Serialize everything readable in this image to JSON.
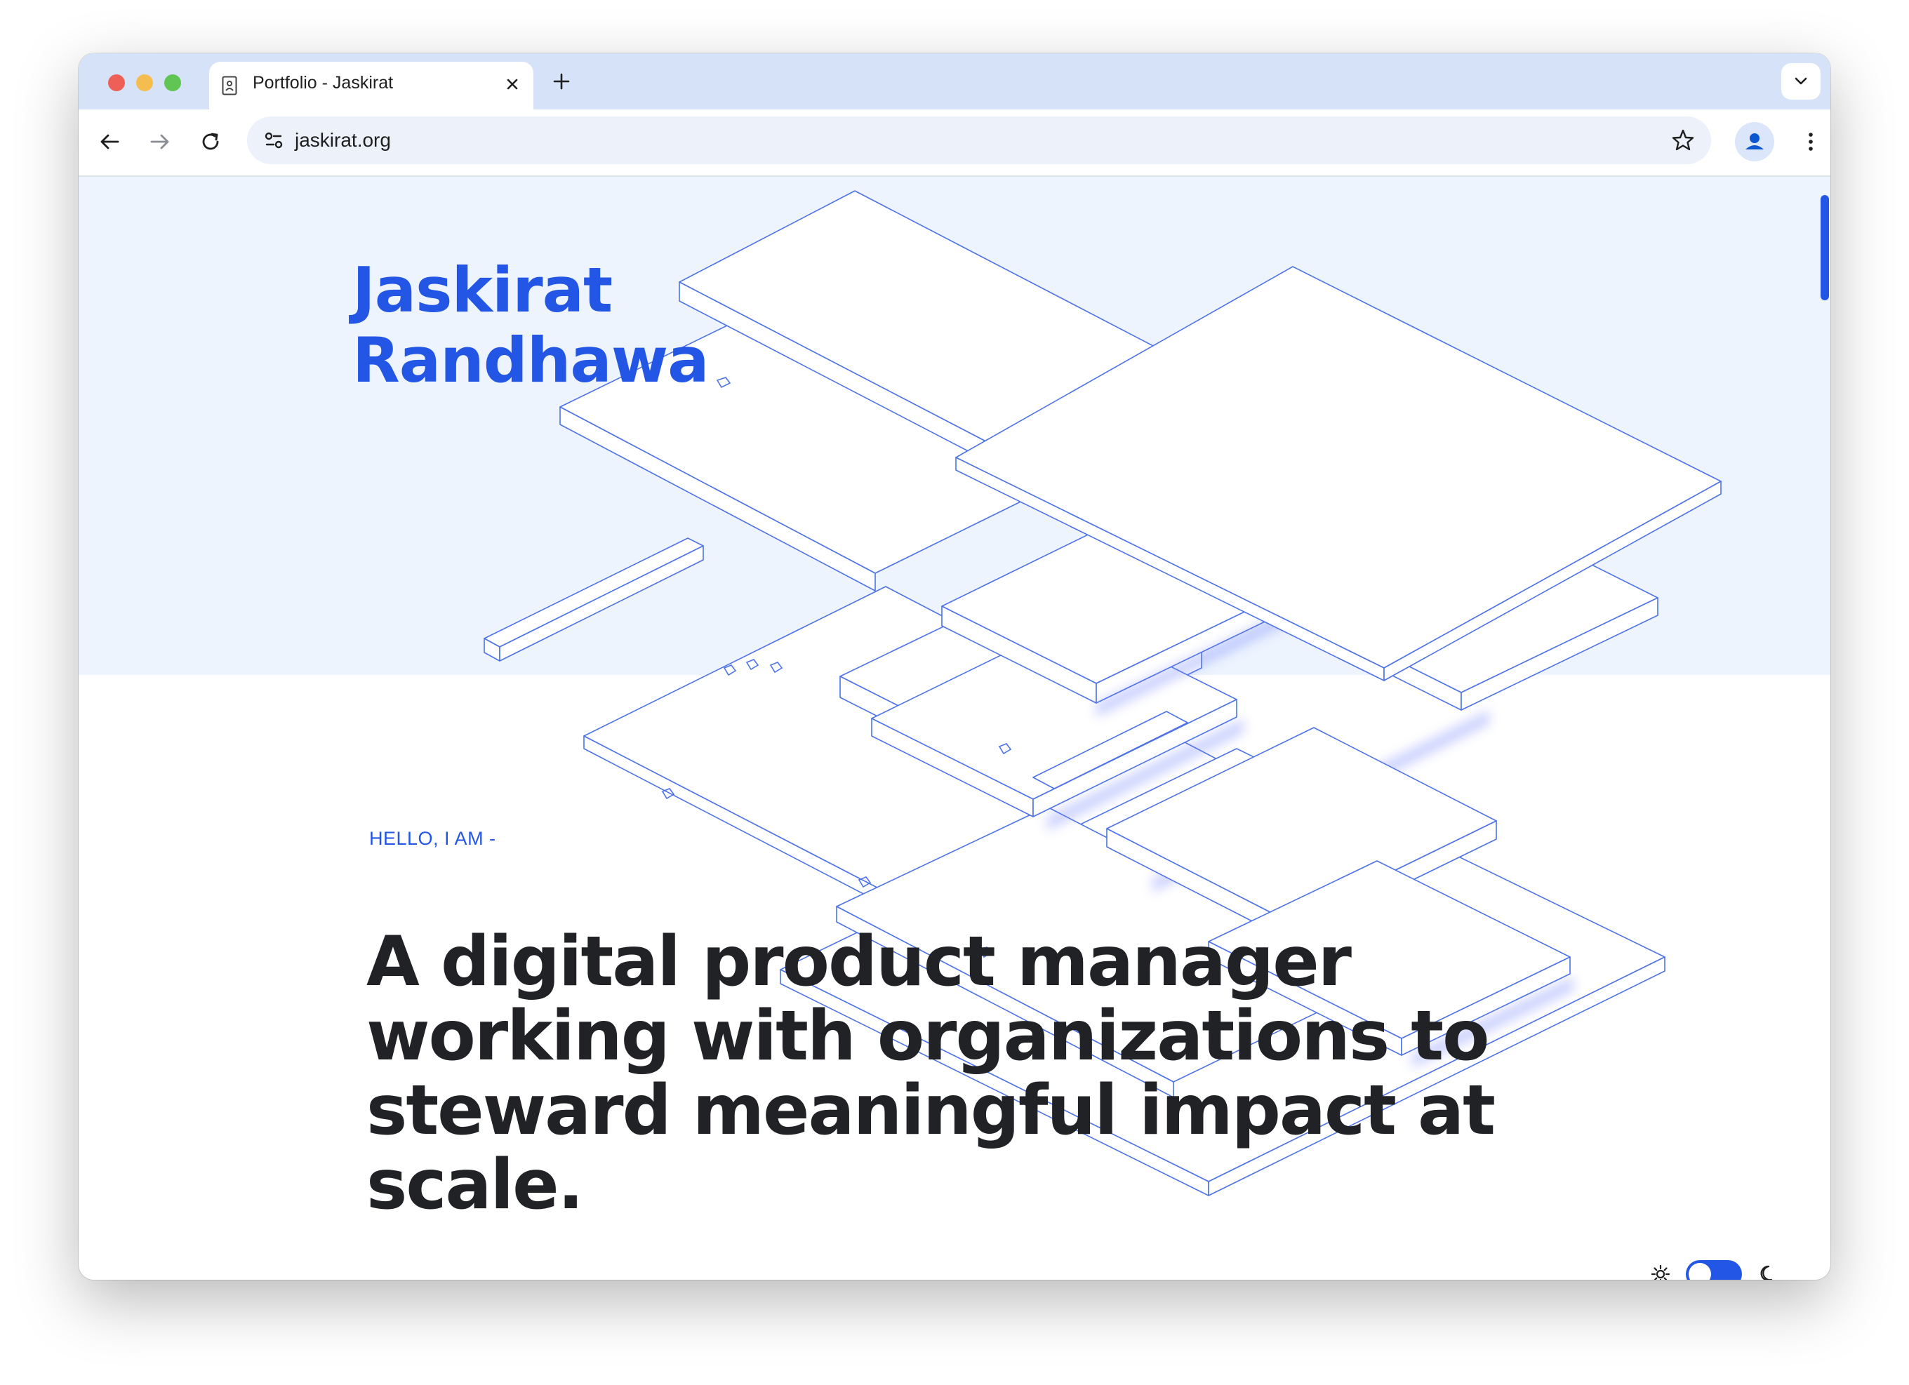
{
  "browser": {
    "tab_title": "Portfolio - Jaskirat",
    "url": "jaskirat.org"
  },
  "page": {
    "name_line1": "Jaskirat",
    "name_line2": "Randhawa",
    "eyebrow": "HELLO, I AM -",
    "headline": "A digital product manager working with organizations to steward meaningful impact at scale.",
    "theme_toggle": {
      "dark_mode": true
    }
  },
  "colors": {
    "accent": "#2456e6",
    "hero_background": "#edf4fe",
    "heading_text": "#212226",
    "tab_strip": "#d6e2f8"
  },
  "icons": [
    "site-info-icon",
    "sun-icon",
    "moon-icon",
    "star-icon",
    "profile-icon"
  ]
}
